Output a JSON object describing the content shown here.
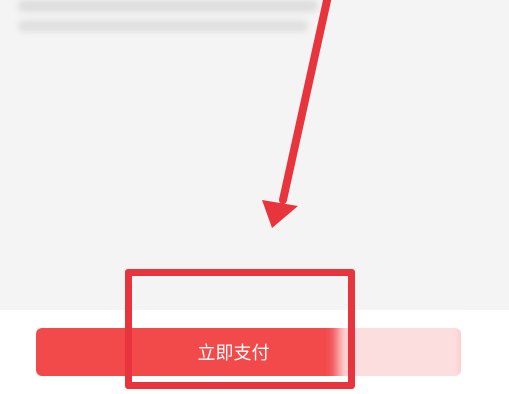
{
  "footer": {
    "pay_button_label": "立即支付"
  },
  "colors": {
    "pay_button_bg": "#f2494b",
    "annotation_red": "#e8343c",
    "page_bg": "#f4f4f4"
  },
  "annotations": {
    "arrow_icon": "arrow-down-icon",
    "highlight": "highlight-box"
  }
}
